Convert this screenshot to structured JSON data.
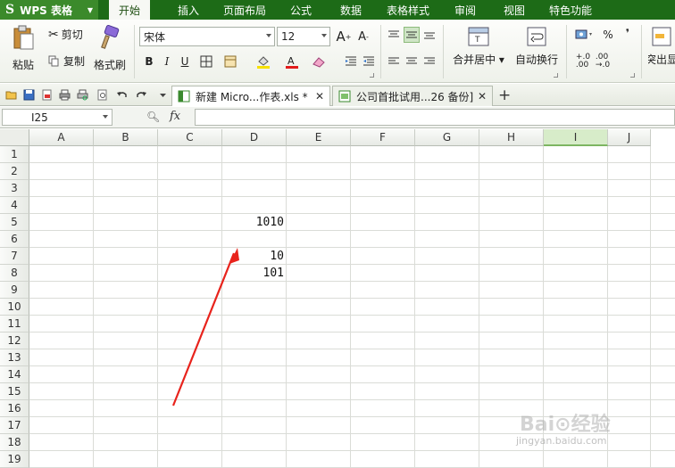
{
  "app": {
    "name": "WPS 表格",
    "logo": "S"
  },
  "menu": {
    "tabs": [
      {
        "label": "开始",
        "active": true
      },
      {
        "label": "插入",
        "active": false
      },
      {
        "label": "页面布局",
        "active": false
      },
      {
        "label": "公式",
        "active": false
      },
      {
        "label": "数据",
        "active": false
      },
      {
        "label": "表格样式",
        "active": false
      },
      {
        "label": "审阅",
        "active": false
      },
      {
        "label": "视图",
        "active": false
      },
      {
        "label": "特色功能",
        "active": false
      }
    ]
  },
  "ribbon": {
    "paste_label": "粘贴",
    "cut_label": "剪切",
    "copy_label": "复制",
    "format_painter_label": "格式刷",
    "font_name": "宋体",
    "font_size": "12",
    "bold": "B",
    "italic": "I",
    "underline": "U",
    "merge_center_label": "合并居中",
    "wrap_text_label": "自动换行",
    "percent_label": "%",
    "comma_label": "❜",
    "highlight_label": "突出显"
  },
  "doc_tabs": [
    {
      "label": "新建 Micro...作表.xls *",
      "active": true
    },
    {
      "label": "公司首批试用...26 备份]",
      "active": false
    }
  ],
  "formula_bar": {
    "name_box": "I25",
    "fx_label": "fx",
    "formula": ""
  },
  "grid": {
    "columns": [
      "A",
      "B",
      "C",
      "D",
      "E",
      "F",
      "G",
      "H",
      "I",
      "J"
    ],
    "selected_column": "I",
    "rows": [
      "1",
      "2",
      "3",
      "4",
      "5",
      "6",
      "7",
      "8",
      "9",
      "10",
      "11",
      "12",
      "13",
      "14",
      "15",
      "16",
      "17",
      "18",
      "19"
    ],
    "cells": [
      {
        "ref": "D5",
        "value": "1010"
      },
      {
        "ref": "D7",
        "value": "10"
      },
      {
        "ref": "D8",
        "value": "101"
      }
    ]
  },
  "annotation": {
    "color": "#e8231c"
  },
  "watermark": {
    "brand": "Bai⊙经验",
    "site": "jingyan.baidu.com"
  },
  "colors": {
    "menu_bg": "#1d6b17",
    "accent": "#3b8a2b",
    "selected_col": "#d7ecc9"
  }
}
